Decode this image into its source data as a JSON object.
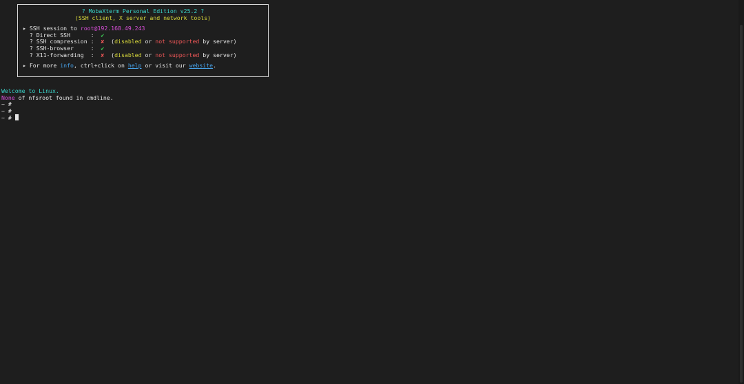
{
  "banner": {
    "title": "? MobaXterm Personal Edition v25.2 ?",
    "subtitle": "(SSH client, X server and network tools)",
    "session_prefix": "▸ SSH session to ",
    "session_host": "root@192.168.49.243",
    "features": [
      {
        "label": "  ? Direct SSH      :  ",
        "mark": "✔",
        "status": "ok"
      },
      {
        "label": "  ? SSH compression :  ",
        "mark": "✘",
        "status": "fail",
        "note_open": "  (",
        "disabled": "disabled",
        "or": " or ",
        "not_supported": "not supported",
        "by_server": " by server)"
      },
      {
        "label": "  ? SSH-browser     :  ",
        "mark": "✔",
        "status": "ok"
      },
      {
        "label": "  ? X11-forwarding  :  ",
        "mark": "✘",
        "status": "fail",
        "note_open": "  (",
        "disabled": "disabled",
        "or": " or ",
        "not_supported": "not supported",
        "by_server": " by server)"
      }
    ],
    "info_prefix": "▸ For more ",
    "info_word": "info",
    "info_mid": ", ctrl+click on ",
    "help_link": "help",
    "info_mid2": " or visit our ",
    "website_link": "website",
    "info_end": "."
  },
  "output": {
    "welcome": "Welcome to Linux.",
    "none_word": "None",
    "none_rest": " of nfsroot found in cmdline.",
    "prompt1": "~ #",
    "prompt2": "~ #",
    "prompt3": "~ # "
  },
  "colors": {
    "background": "#1e1e1e",
    "cyan": "#3ad4c9",
    "yellow": "#dada3c",
    "magenta": "#d94fd9",
    "green": "#3edc5a",
    "red": "#f25858",
    "blue": "#46a0e6"
  }
}
